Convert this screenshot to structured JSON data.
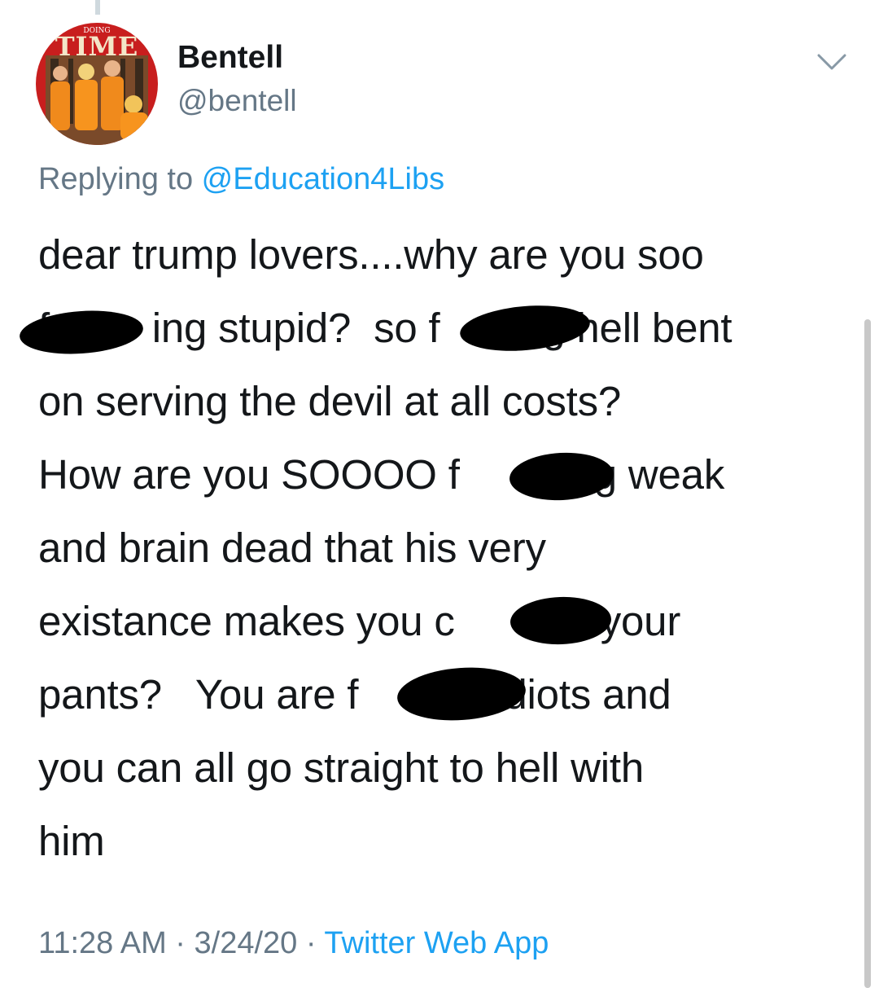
{
  "tweet": {
    "author": {
      "display_name": "Bentell",
      "handle": "@bentell",
      "avatar": {
        "icon": "profile-avatar-icon",
        "masthead_text": "TIME",
        "tagline_text": "DOING"
      }
    },
    "reply": {
      "prefix": "Replying to ",
      "mention": "@Education4Libs"
    },
    "body_lines": [
      "dear trump lovers....why are you soo",
      "f         ing stupid?  so f         g hell bent",
      "on serving the devil at all costs?",
      "How are you SOOOO f         ing weak",
      "and brain dead that his very",
      "existance makes you c         in your",
      "pants?   You are f         g idiots and",
      "you can all go straight to hell with",
      "him"
    ],
    "meta": {
      "time": "11:28 AM",
      "separator": " · ",
      "date": "3/24/20",
      "source": "Twitter Web App"
    },
    "colors": {
      "text": "#14171a",
      "secondary": "#657786",
      "link": "#1da1f2",
      "redaction": "#000000"
    }
  }
}
